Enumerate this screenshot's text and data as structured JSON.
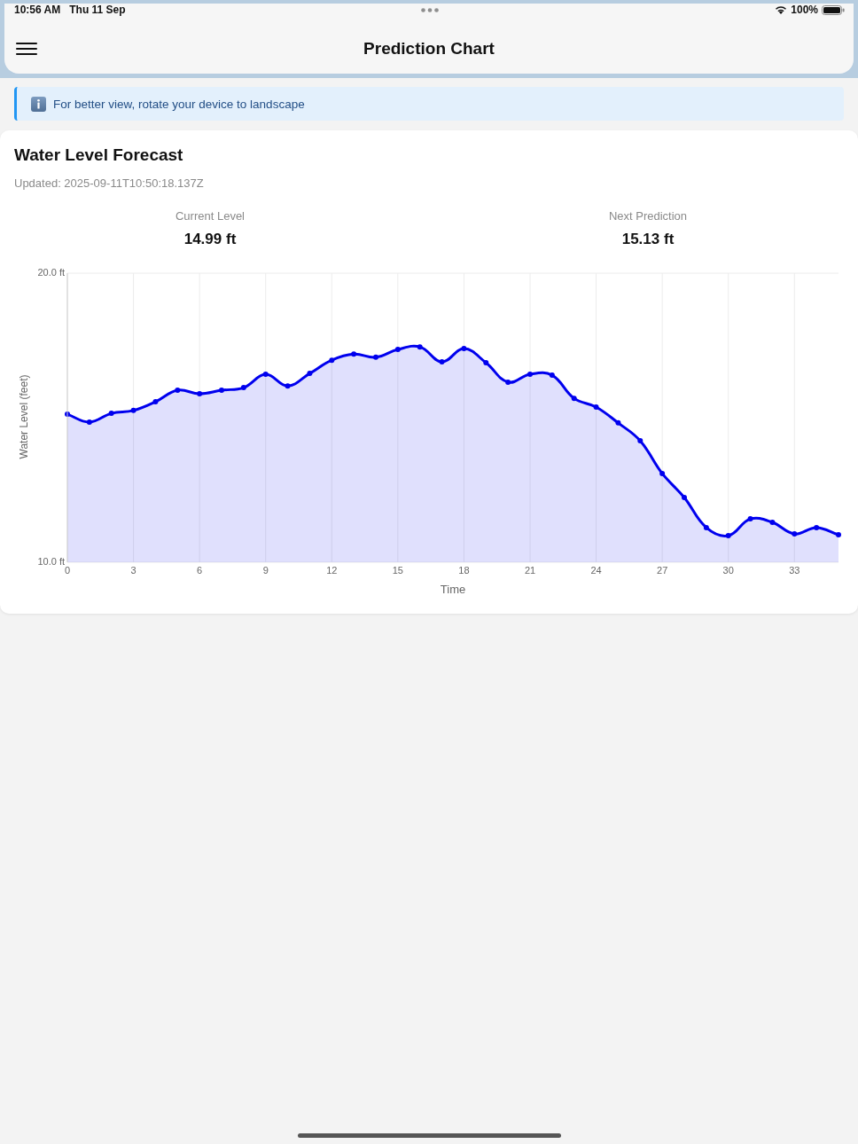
{
  "status_bar": {
    "time": "10:56 AM",
    "date": "Thu 11 Sep",
    "battery": "100%"
  },
  "header": {
    "title": "Prediction Chart"
  },
  "notice": {
    "text": "For better view, rotate your device to landscape"
  },
  "forecast": {
    "title": "Water Level Forecast",
    "updated": "Updated: 2025-09-11T10:50:18.137Z",
    "stats": [
      {
        "label": "Current Level",
        "value": "14.99 ft"
      },
      {
        "label": "Next Prediction",
        "value": "15.13 ft"
      }
    ],
    "chart_data": {
      "type": "area",
      "xlabel": "Time",
      "ylabel": "Water Level (feet)",
      "x": [
        0,
        1,
        2,
        3,
        4,
        5,
        6,
        7,
        8,
        9,
        10,
        11,
        12,
        13,
        14,
        15,
        16,
        17,
        18,
        19,
        20,
        21,
        22,
        23,
        24,
        25,
        26,
        27,
        28,
        29,
        30,
        31,
        32,
        33,
        34,
        35
      ],
      "series": [
        {
          "color": "#0000ee",
          "values": [
            15.12,
            14.85,
            15.15,
            15.25,
            15.55,
            15.95,
            15.83,
            15.95,
            16.04,
            16.5,
            16.1,
            16.53,
            16.99,
            17.2,
            17.09,
            17.36,
            17.45,
            16.93,
            17.39,
            16.9,
            16.23,
            16.5,
            16.47,
            15.67,
            15.37,
            14.82,
            14.2,
            13.07,
            12.24,
            11.2,
            10.92,
            11.5,
            11.38,
            10.98,
            11.2,
            10.95
          ]
        }
      ],
      "xlim": [
        0,
        35
      ],
      "ylim": [
        10,
        20
      ],
      "xticks": [
        0,
        3,
        6,
        9,
        12,
        15,
        18,
        21,
        24,
        27,
        30,
        33
      ],
      "yticks": [
        {
          "value": 10,
          "label": "10.0 ft"
        },
        {
          "value": 20,
          "label": "20.0 ft"
        }
      ],
      "grid": true
    }
  }
}
